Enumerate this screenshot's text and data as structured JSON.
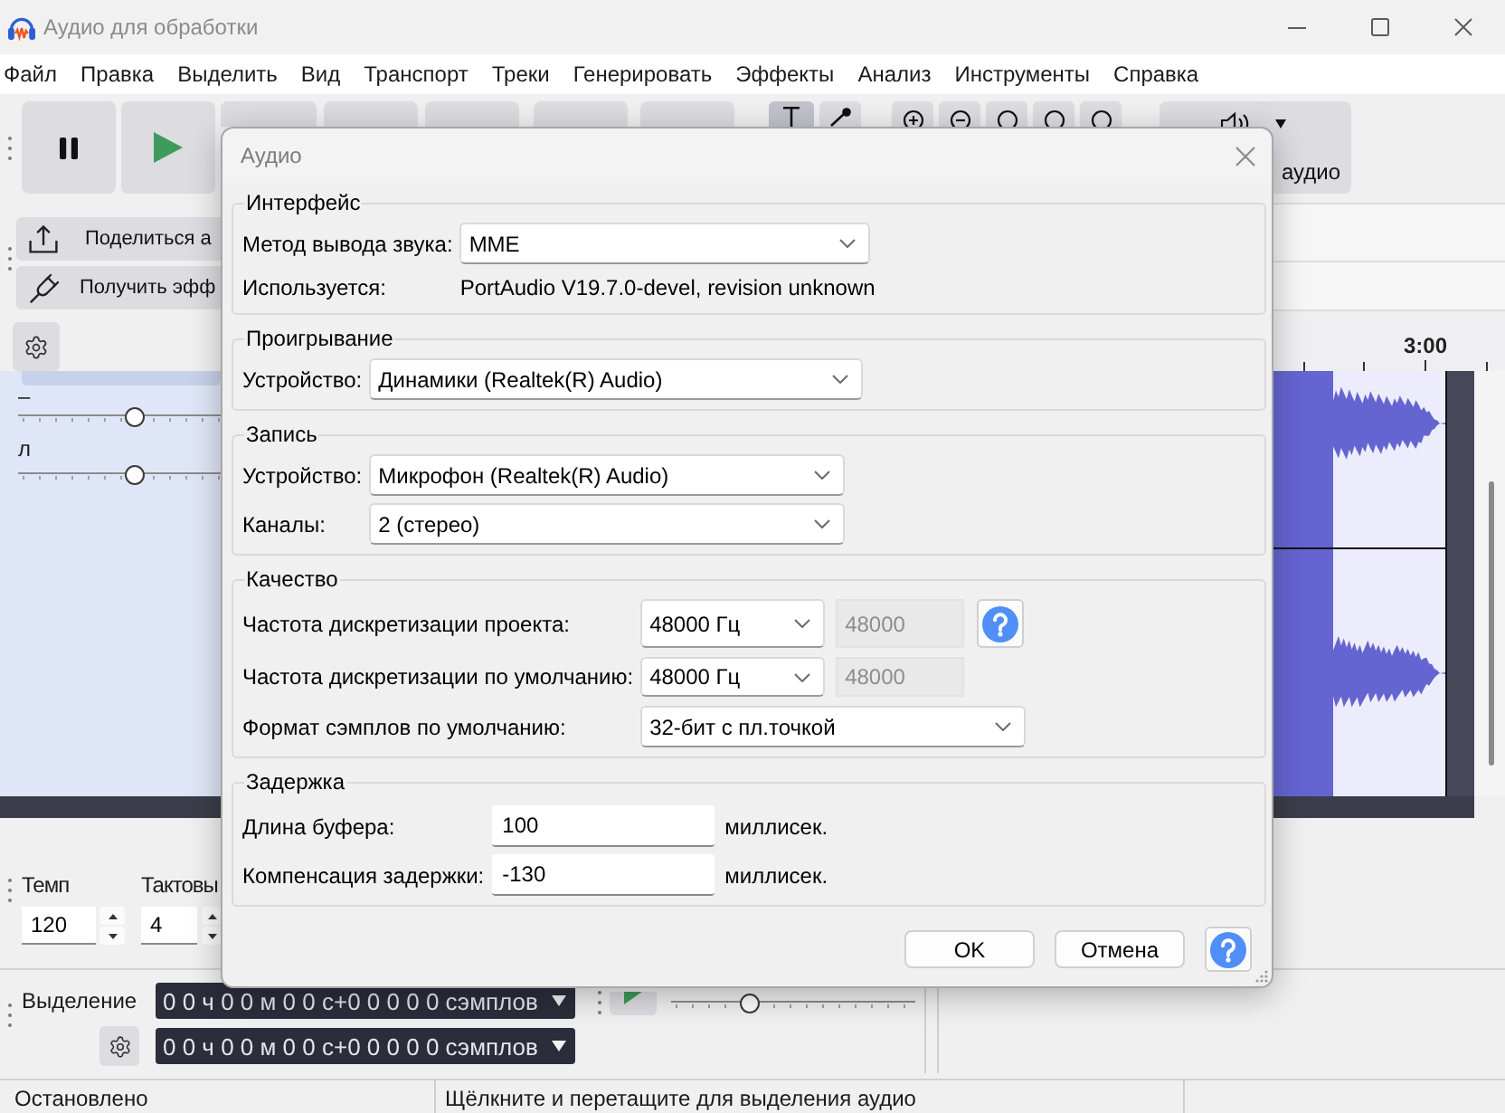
{
  "window": {
    "title": "Аудио для обработки"
  },
  "menu": [
    "Файл",
    "Правка",
    "Выделить",
    "Вид",
    "Транспорт",
    "Треки",
    "Генерировать",
    "Эффекты",
    "Анализ",
    "Инструменты",
    "Справка"
  ],
  "tools": [
    {
      "selected": true
    },
    {
      "selected": false
    }
  ],
  "audio_setup": {
    "label": "аудио"
  },
  "share_toolbar": [
    {
      "label": "Поделиться а"
    },
    {
      "label": "Получить эфф"
    }
  ],
  "ruler": {
    "label": "3:00"
  },
  "track": {
    "sliders": [
      {
        "label": "–",
        "level": 0.58
      },
      {
        "label": "л",
        "level": 0.58
      }
    ]
  },
  "time_signature": [
    {
      "label": "Темп",
      "value": "120"
    },
    {
      "label": "Тактовы",
      "value": "4"
    }
  ],
  "selection": {
    "label": "Выделение",
    "times": [
      "0 0 ч 0 0 м 0 0 с+0 0 0 0 0 сэмплов",
      "0 0 ч 0 0 м 0 0 с+0 0 0 0 0 сэмплов"
    ]
  },
  "play_at_speed": {
    "level": 0.31
  },
  "status_bar": [
    "Остановлено",
    "Щёлкните и перетащите для выделения аудио"
  ],
  "dialog": {
    "title": "Аудио",
    "groups": [
      {
        "title": "Интерфейс",
        "rows": [
          {
            "kind": "select",
            "label": "Метод вывода звука:",
            "value": "MME"
          },
          {
            "kind": "info",
            "label": "Используется:",
            "value": "PortAudio V19.7.0-devel, revision unknown"
          }
        ]
      },
      {
        "title": "Проигрывание",
        "rows": [
          {
            "kind": "select",
            "label": "Устройство:",
            "value": "Динамики (Realtek(R) Audio)"
          }
        ]
      },
      {
        "title": "Запись",
        "rows": [
          {
            "kind": "select",
            "label": "Устройство:",
            "value": "Микрофон (Realtek(R) Audio)"
          },
          {
            "kind": "select",
            "label": "Каналы:",
            "value": "2 (стерео)"
          }
        ]
      },
      {
        "title": "Качество",
        "rows": [
          {
            "kind": "rate",
            "label": "Частота дискретизации проекта:",
            "value": "48000 Гц",
            "rate_field": {
              "value": "48000",
              "disabled": true
            },
            "help": true
          },
          {
            "kind": "rate",
            "label": "Частота дискретизации по умолчанию:",
            "value": "48000 Гц",
            "rate_field": {
              "value": "48000",
              "disabled": true
            }
          },
          {
            "kind": "select",
            "label": "Формат сэмплов по умолчанию:",
            "value": "32-бит с пл.точкой"
          }
        ]
      },
      {
        "title": "Задержка",
        "rows": [
          {
            "kind": "number",
            "label": "Длина буфера:",
            "value": "100",
            "unit": "миллисек."
          },
          {
            "kind": "number",
            "label": "Компенсация задержки:",
            "value": "-130",
            "unit": "миллисек."
          }
        ]
      }
    ],
    "buttons": [
      {
        "kind": "button",
        "label": "OK"
      },
      {
        "kind": "button",
        "label": "Отмена"
      },
      {
        "kind": "help"
      }
    ]
  }
}
